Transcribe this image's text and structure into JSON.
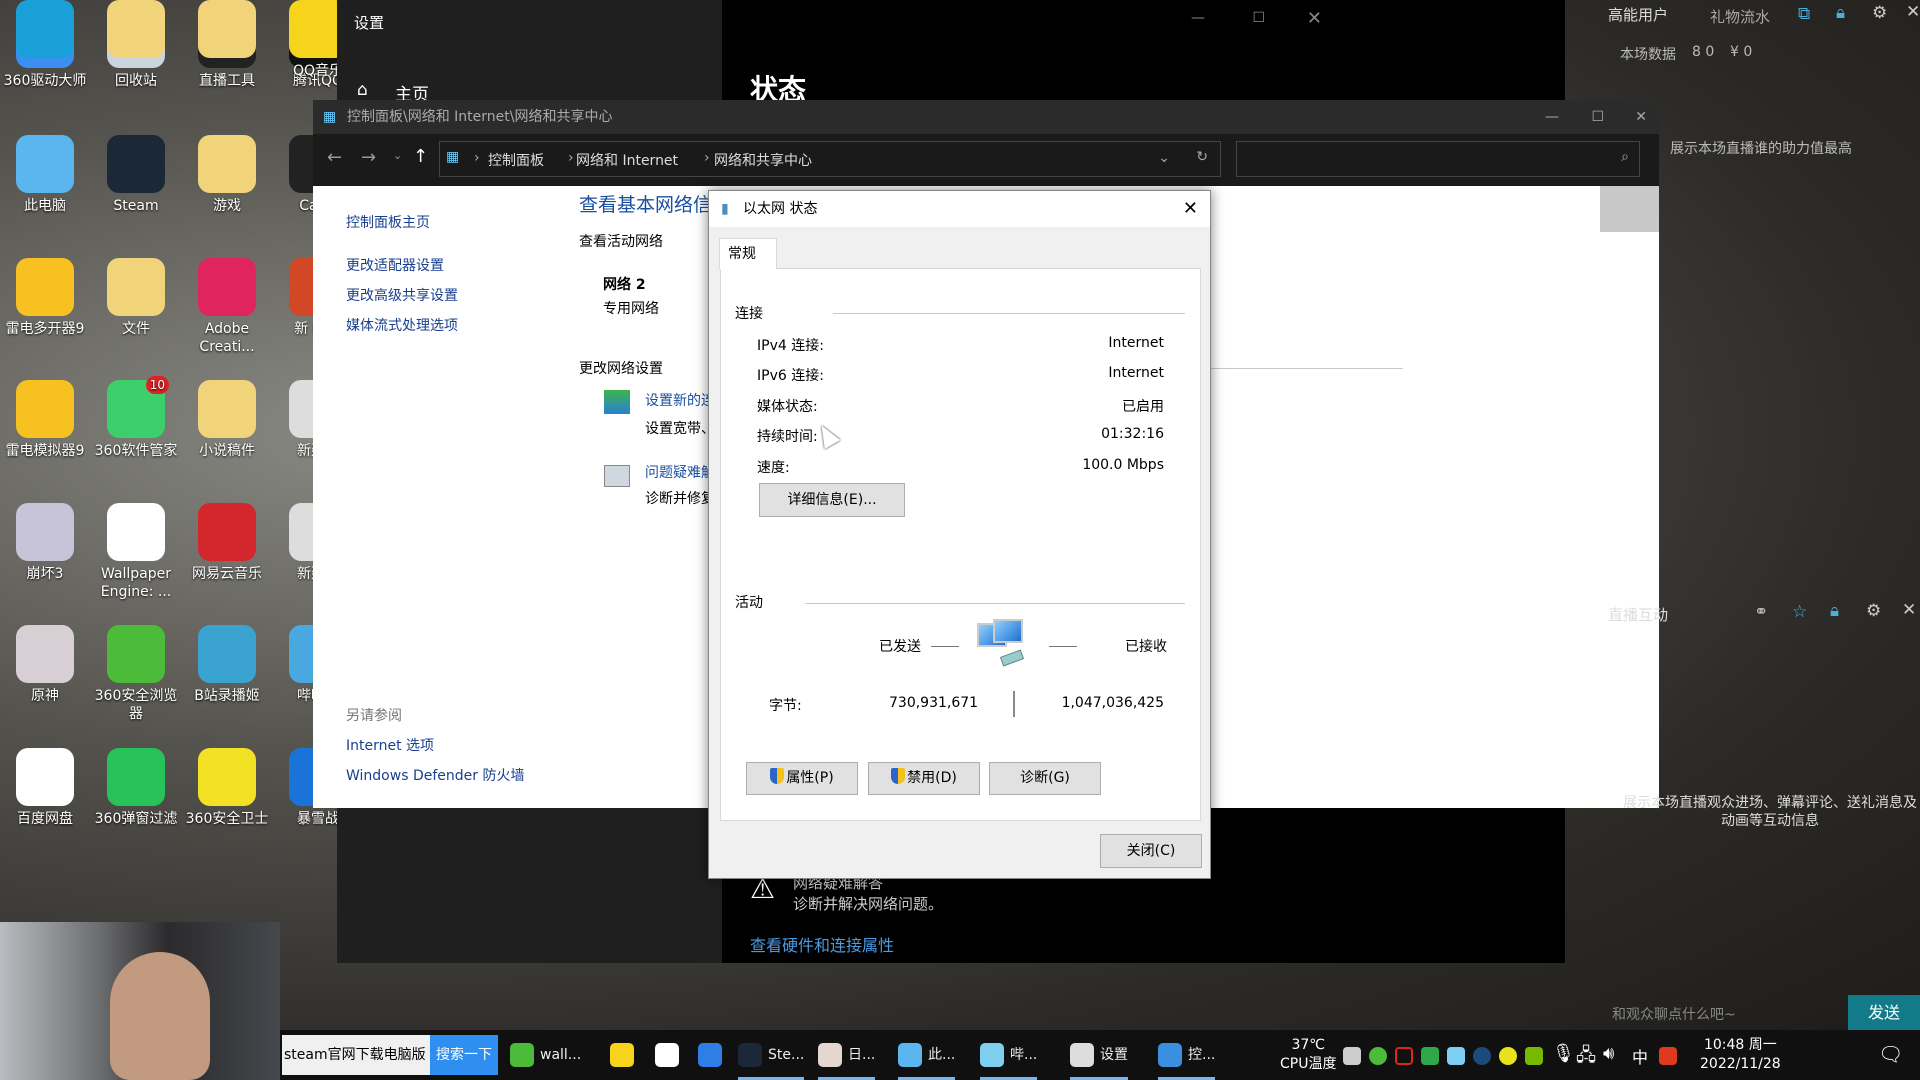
{
  "desktop": {
    "icons": [
      {
        "label": "360驱动大师",
        "color": "#3a8ff0"
      },
      {
        "label": "回收站",
        "color": "#c9d4dc"
      },
      {
        "label": "直播工具",
        "color": "#222"
      },
      {
        "label": "腾讯QQ",
        "color": "#111"
      },
      {
        "label": "此电脑",
        "color": "#5bb6f0"
      },
      {
        "label": "Steam",
        "color": "#1b2838"
      },
      {
        "label": "游戏",
        "color": "#f1d37a"
      },
      {
        "label": "Ca Te",
        "color": "#222"
      },
      {
        "label": "雷电多开器9",
        "color": "#f7c221"
      },
      {
        "label": "文件",
        "color": "#f1d37a"
      },
      {
        "label": "Adobe Creati...",
        "color": "#e0245e"
      },
      {
        "label": "新 Micr",
        "color": "#d24726"
      },
      {
        "label": "雷电模拟器9",
        "color": "#f7c221"
      },
      {
        "label": "360软件管家",
        "color": "#3ccf6b",
        "badge": "10"
      },
      {
        "label": "小说稿件",
        "color": "#f1d37a"
      },
      {
        "label": "新建文",
        "color": "#ddd"
      },
      {
        "label": "崩坏3",
        "color": "#c7c3d8"
      },
      {
        "label": "Wallpaper Engine: ...",
        "color": "#ffffff"
      },
      {
        "label": "网易云音乐",
        "color": "#d3262d"
      },
      {
        "label": "新建文",
        "color": "#ddd"
      },
      {
        "label": "原神",
        "color": "#d8cfd5"
      },
      {
        "label": "360安全浏览器",
        "color": "#4cbb3a"
      },
      {
        "label": "B站录播姬",
        "color": "#3aa3d0"
      },
      {
        "label": "哔哩哔",
        "color": "#4aa8e0"
      },
      {
        "label": "百度网盘",
        "color": "#ffffff"
      },
      {
        "label": "360弹窗过滤",
        "color": "#27c35a"
      },
      {
        "label": "360安全卫士",
        "color": "#f3e224"
      },
      {
        "label": "暴雪战",
        "color": "#1a74d8"
      },
      {
        "label": "",
        "color": "#1aa0d8"
      },
      {
        "label": "",
        "color": "#f1d37a"
      },
      {
        "label": "",
        "color": "#f1d37a"
      },
      {
        "label": "QQ音乐",
        "color": "#f6d41c"
      }
    ]
  },
  "settings": {
    "title": "设置",
    "home": "主页",
    "heading": "状态",
    "troubleshoot_title": "网络疑难解答",
    "troubleshoot_desc": "诊断并解决网络问题。",
    "hw_link": "查看硬件和连接属性"
  },
  "control_panel": {
    "title": "控制面板\\网络和 Internet\\网络和共享中心",
    "breadcrumb": [
      "控制面板",
      "网络和 Internet",
      "网络和共享中心"
    ],
    "search_placeholder": "",
    "sidebar": {
      "items": [
        "控制面板主页",
        "更改适配器设置",
        "更改高级共享设置",
        "媒体流式处理选项"
      ],
      "see_also": "另请参阅",
      "see_also_items": [
        "Internet 选项",
        "Windows Defender 防火墙"
      ]
    },
    "main": {
      "heading": "查看基本网络信",
      "active_networks": "查看活动网络",
      "network_name": "网络 2",
      "network_type": "专用网络",
      "change_settings": "更改网络设置",
      "tasks": [
        {
          "link": "设置新的连",
          "desc": "设置宽带、"
        },
        {
          "link": "问题疑难解",
          "desc": "诊断并修复"
        }
      ]
    }
  },
  "dialog": {
    "title": "以太网 状态",
    "tab": "常规",
    "connection_section": "连接",
    "rows": [
      {
        "label": "IPv4 连接:",
        "value": "Internet"
      },
      {
        "label": "IPv6 连接:",
        "value": "Internet"
      },
      {
        "label": "媒体状态:",
        "value": "已启用"
      },
      {
        "label": "持续时间:",
        "value": "01:32:16"
      },
      {
        "label": "速度:",
        "value": "100.0 Mbps"
      }
    ],
    "details_button": "详细信息(E)...",
    "activity_section": "活动",
    "sent_label": "已发送",
    "received_label": "已接收",
    "bytes_label": "字节:",
    "bytes_sent": "730,931,671",
    "bytes_received": "1,047,036,425",
    "properties_button": "属性(P)",
    "disable_button": "禁用(D)",
    "diagnose_button": "诊断(G)",
    "close_button": "关闭(C)"
  },
  "overlay": {
    "top": {
      "tab1": "高能用户",
      "tab2": "礼物流水",
      "stats_label": "本场数据",
      "viewers": "8 0",
      "revenue": "¥ 0",
      "hint": "展示本场直播谁的助力值最高"
    },
    "interact": {
      "title": "直播互动",
      "hint": "展示本场直播观众进场、弹幕评论、送礼消息及动画等互动信息"
    },
    "chat_placeholder": "和观众聊点什么吧~",
    "send": "发送"
  },
  "taskbar": {
    "search_value": "steam官网下载电脑版",
    "search_button": "搜索一下",
    "apps": [
      {
        "label": "wall...",
        "color": "#4cbb3a"
      },
      {
        "label": "",
        "color": "#f6d41c"
      },
      {
        "label": "",
        "color": "#ffffff"
      },
      {
        "label": "",
        "color": "#2f7ee8"
      },
      {
        "label": "Ste...",
        "color": "#1b2838"
      },
      {
        "label": "日...",
        "color": "#e6d6d0"
      },
      {
        "label": "此...",
        "color": "#5bb6f0"
      },
      {
        "label": "哔...",
        "color": "#7fd0f0"
      },
      {
        "label": "设置",
        "color": "#dddddd"
      },
      {
        "label": "控...",
        "color": "#3a8fe0"
      }
    ],
    "cpu_temp": "37℃",
    "cpu_label": "CPU温度",
    "ime": "中",
    "time": "10:48 周一",
    "date": "2022/11/28"
  }
}
